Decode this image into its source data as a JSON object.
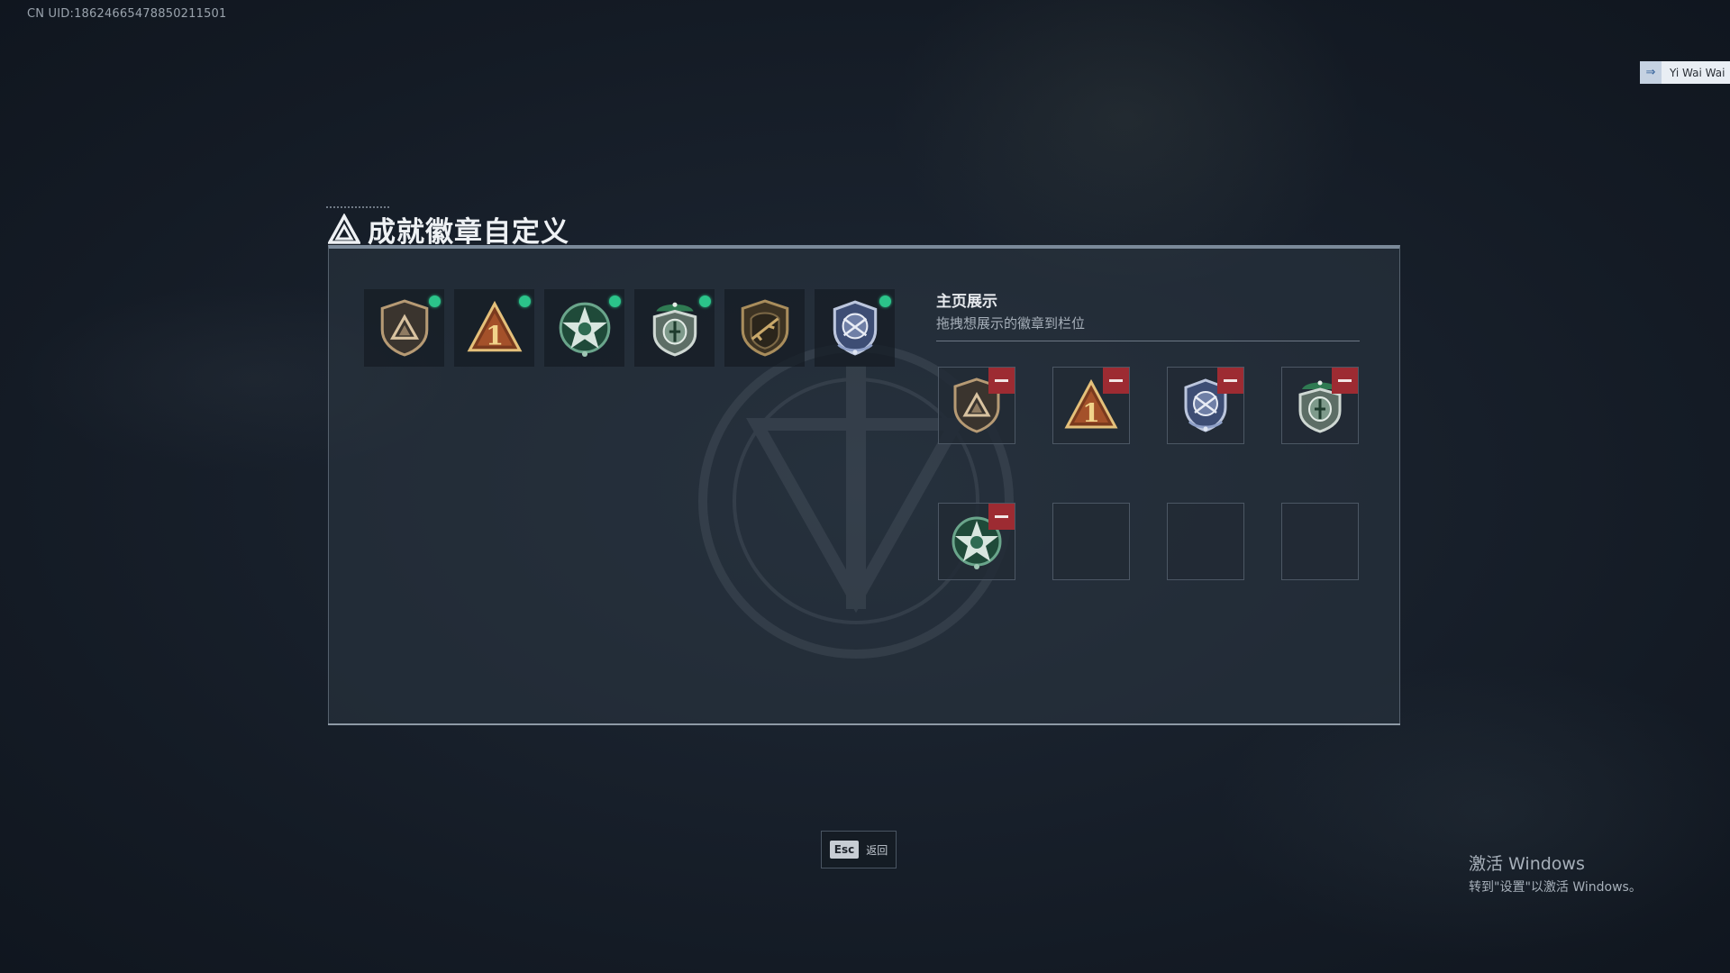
{
  "uid_text": "CN UID:1862466547885021​1501",
  "user": {
    "name": "Yi Wai Wai",
    "icon": "signin-icon"
  },
  "page": {
    "title": "成就徽章自定义",
    "logo": "triangle-logo-icon"
  },
  "owned_badges": [
    {
      "name": "bronze-triangle-shield-badge",
      "equipped": true
    },
    {
      "name": "rank-one-triangle-badge",
      "equipped": true
    },
    {
      "name": "green-star-wreath-badge",
      "equipped": true
    },
    {
      "name": "green-beret-shield-badge",
      "equipped": true
    },
    {
      "name": "rifle-shield-badge",
      "equipped": false
    },
    {
      "name": "blue-eagle-globe-badge",
      "equipped": true
    }
  ],
  "showcase": {
    "title": "主页展示",
    "subtitle": "拖拽想展示的徽章到栏位",
    "slots": [
      {
        "badge": "bronze-triangle-shield-badge",
        "remove_icon": "minus-icon"
      },
      {
        "badge": "rank-one-triangle-badge",
        "remove_icon": "minus-icon"
      },
      {
        "badge": "blue-eagle-globe-badge",
        "remove_icon": "minus-icon"
      },
      {
        "badge": "green-beret-shield-badge",
        "remove_icon": "minus-icon"
      },
      {
        "badge": "green-star-wreath-badge",
        "remove_icon": "minus-icon"
      },
      {
        "badge": null
      },
      {
        "badge": null
      },
      {
        "badge": null
      }
    ]
  },
  "footer": {
    "esc_key": "Esc",
    "esc_label": "返回"
  },
  "windows_watermark": {
    "line1": "激活 Windows",
    "line2": "转到\"设置\"以激活 Windows。"
  },
  "colors": {
    "equipped_dot": "#2bc48a",
    "remove_button": "#9d2b32",
    "panel_border": "#7b8a9a"
  }
}
